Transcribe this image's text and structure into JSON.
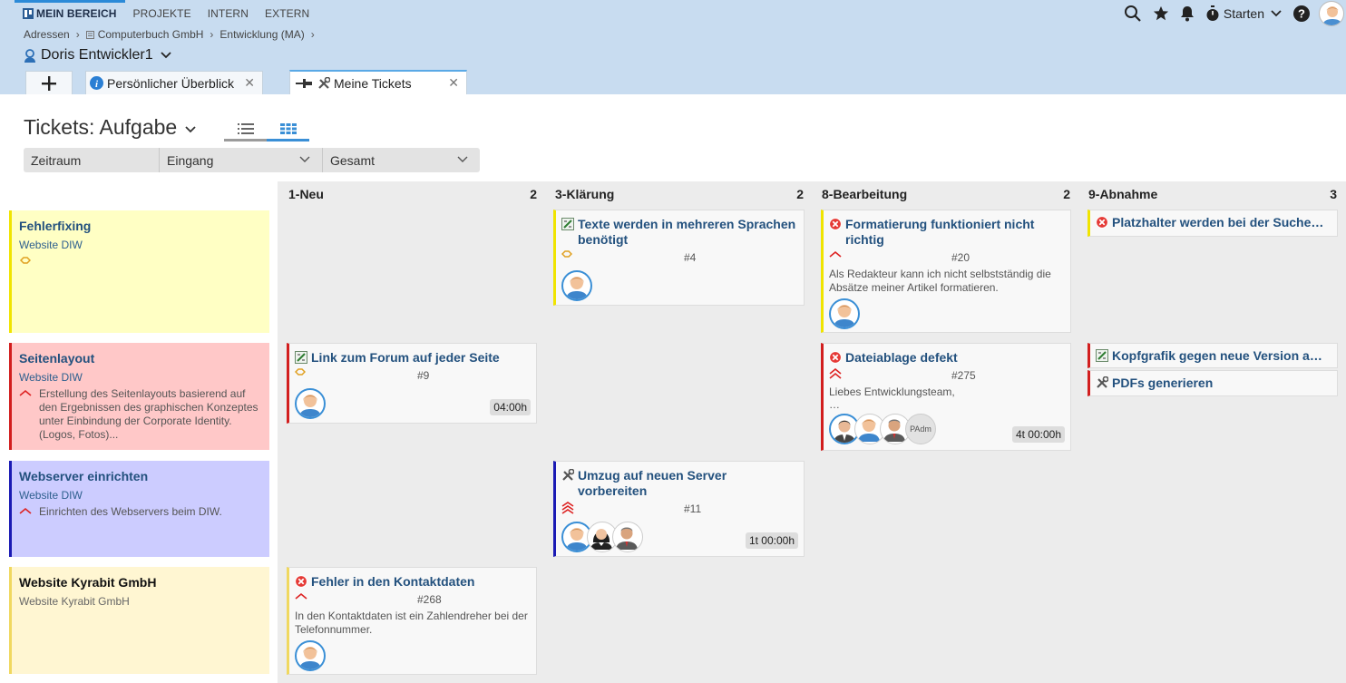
{
  "topnav": {
    "items": [
      "MEIN BEREICH",
      "PROJEKTE",
      "INTERN",
      "EXTERN"
    ]
  },
  "tools": {
    "starten_label": "Starten"
  },
  "breadcrumb": {
    "items": [
      "Adressen",
      "Computerbuch GmbH",
      "Entwicklung (MA)"
    ]
  },
  "person": {
    "name": "Doris Entwickler1"
  },
  "tabs": {
    "items": [
      "Persönlicher Überblick",
      "Meine Tickets"
    ]
  },
  "page": {
    "title": "Tickets: Aufgabe"
  },
  "filters": {
    "items": [
      "Zeitraum",
      "Eingang",
      "Gesamt"
    ]
  },
  "columns": [
    {
      "name": "1-Neu",
      "count": "2"
    },
    {
      "name": "3-Klärung",
      "count": "2"
    },
    {
      "name": "8-Bearbeitung",
      "count": "2"
    },
    {
      "name": "9-Abnahme",
      "count": "3"
    }
  ],
  "lanes": [
    {
      "title": "Fehlerfixing",
      "subtitle": "Website DIW",
      "description": "",
      "color": "#f0e400",
      "bg": "#ffffc4"
    },
    {
      "title": "Seitenlayout",
      "subtitle": "Website DIW",
      "description": "Erstellung des Seitenlayouts basierend auf den Ergebnissen des graphischen Konzeptes unter Einbindung der Corporate Identity. (Logos, Fotos)...",
      "color": "#d21e1e",
      "bg": "#ffc8c8"
    },
    {
      "title": "Webserver einrichten",
      "subtitle": "Website DIW",
      "description": "Einrichten des Webservers beim DIW.",
      "color": "#1a1ab4",
      "bg": "#ccccff"
    },
    {
      "title": "Website Kyrabit GmbH",
      "subtitle": "Website Kyrabit GmbH",
      "description": "",
      "color": "#f0d860",
      "bg": "#fff6d2"
    }
  ],
  "cards": [
    {
      "title": "Texte werden in mehreren Sprachen benötigt",
      "number": "#4",
      "text": "",
      "duration": "",
      "priority": "normal",
      "type": "task",
      "color": "#f0e400"
    },
    {
      "title": "Formatierung funktioniert nicht richtig",
      "number": "#20",
      "text": "Als Redakteur kann ich nicht selbstständig die Absätze meiner Artikel formatieren.",
      "duration": "",
      "priority": "high",
      "type": "bug",
      "color": "#f0e400"
    },
    {
      "title": "Platzhalter werden bei der Suche…",
      "number": "",
      "text": "",
      "duration": "",
      "priority": "",
      "type": "bug",
      "color": "#f0e400"
    },
    {
      "title": "Link zum Forum auf jeder Seite",
      "number": "#9",
      "text": "",
      "duration": "04:00h",
      "priority": "normal",
      "type": "task",
      "color": "#d21e1e"
    },
    {
      "title": "Dateiablage defekt",
      "number": "#275",
      "text": "Liebes Entwicklungsteam,",
      "text2": "…",
      "duration": "4t 00:00h",
      "priority": "veryhigh",
      "type": "bug",
      "color": "#d21e1e",
      "padm": "PAdm"
    },
    {
      "title": "Kopfgrafik gegen neue Version a…",
      "number": "",
      "text": "",
      "duration": "",
      "priority": "",
      "type": "task",
      "color": "#d21e1e"
    },
    {
      "title": "PDFs generieren",
      "number": "",
      "text": "",
      "duration": "",
      "priority": "",
      "type": "tools",
      "color": "#d21e1e"
    },
    {
      "title": "Umzug auf neuen Server vorbereiten",
      "number": "#11",
      "text": "",
      "duration": "1t 00:00h",
      "priority": "highest",
      "type": "tools",
      "color": "#1a1ab4"
    },
    {
      "title": "Fehler in den Kontaktdaten",
      "number": "#268",
      "text": "In den Kontaktdaten ist ein Zahlendreher bei der Telefonnummer.",
      "duration": "",
      "priority": "high",
      "type": "bug",
      "color": "#f0d860"
    }
  ]
}
